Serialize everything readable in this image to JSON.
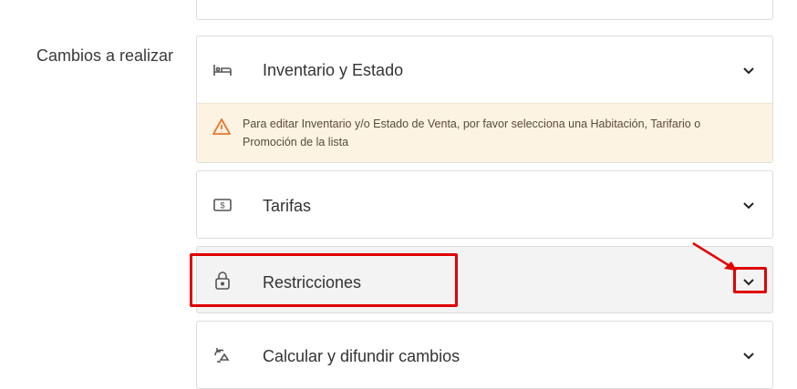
{
  "section": {
    "label": "Cambios a realizar"
  },
  "cards": [
    {
      "title": "Inventario y Estado",
      "icon": "bed-icon"
    },
    {
      "title": "Tarifas",
      "icon": "money-icon"
    },
    {
      "title": "Restricciones",
      "icon": "lock-icon"
    },
    {
      "title": "Calcular y difundir cambios",
      "icon": "sync-icon"
    }
  ],
  "warning": {
    "icon": "warning-icon",
    "text": "Para editar Inventario y/o Estado de Venta, por favor selecciona una Habitación, Tarifario o Promoción de la lista"
  },
  "colors": {
    "accent_red": "#e00000",
    "warning_bg": "#fdf3e3",
    "warning_icon": "#e8772e"
  }
}
